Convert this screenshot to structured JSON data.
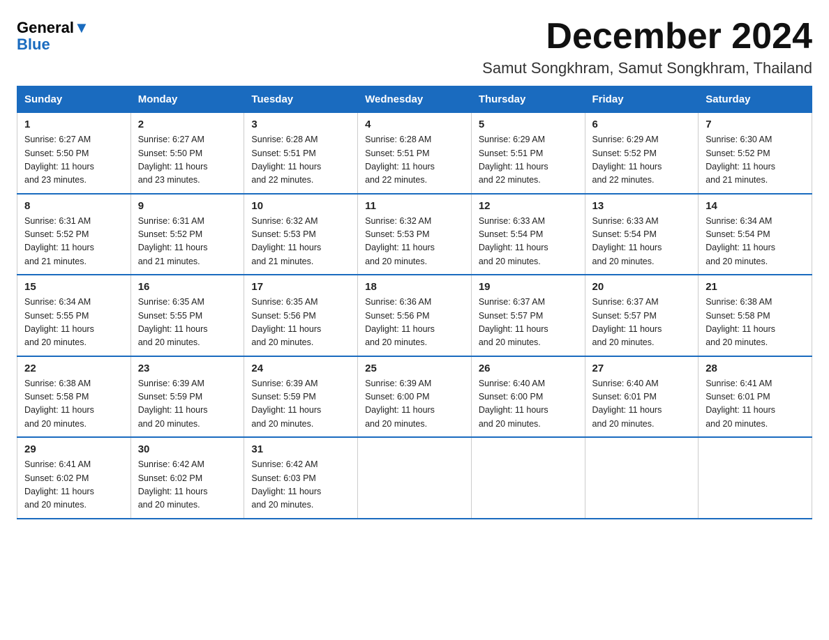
{
  "logo": {
    "line1": "General",
    "line2": "Blue"
  },
  "title": "December 2024",
  "location": "Samut Songkhram, Samut Songkhram, Thailand",
  "days_of_week": [
    "Sunday",
    "Monday",
    "Tuesday",
    "Wednesday",
    "Thursday",
    "Friday",
    "Saturday"
  ],
  "weeks": [
    [
      {
        "day": "1",
        "info": "Sunrise: 6:27 AM\nSunset: 5:50 PM\nDaylight: 11 hours\nand 23 minutes."
      },
      {
        "day": "2",
        "info": "Sunrise: 6:27 AM\nSunset: 5:50 PM\nDaylight: 11 hours\nand 23 minutes."
      },
      {
        "day": "3",
        "info": "Sunrise: 6:28 AM\nSunset: 5:51 PM\nDaylight: 11 hours\nand 22 minutes."
      },
      {
        "day": "4",
        "info": "Sunrise: 6:28 AM\nSunset: 5:51 PM\nDaylight: 11 hours\nand 22 minutes."
      },
      {
        "day": "5",
        "info": "Sunrise: 6:29 AM\nSunset: 5:51 PM\nDaylight: 11 hours\nand 22 minutes."
      },
      {
        "day": "6",
        "info": "Sunrise: 6:29 AM\nSunset: 5:52 PM\nDaylight: 11 hours\nand 22 minutes."
      },
      {
        "day": "7",
        "info": "Sunrise: 6:30 AM\nSunset: 5:52 PM\nDaylight: 11 hours\nand 21 minutes."
      }
    ],
    [
      {
        "day": "8",
        "info": "Sunrise: 6:31 AM\nSunset: 5:52 PM\nDaylight: 11 hours\nand 21 minutes."
      },
      {
        "day": "9",
        "info": "Sunrise: 6:31 AM\nSunset: 5:52 PM\nDaylight: 11 hours\nand 21 minutes."
      },
      {
        "day": "10",
        "info": "Sunrise: 6:32 AM\nSunset: 5:53 PM\nDaylight: 11 hours\nand 21 minutes."
      },
      {
        "day": "11",
        "info": "Sunrise: 6:32 AM\nSunset: 5:53 PM\nDaylight: 11 hours\nand 20 minutes."
      },
      {
        "day": "12",
        "info": "Sunrise: 6:33 AM\nSunset: 5:54 PM\nDaylight: 11 hours\nand 20 minutes."
      },
      {
        "day": "13",
        "info": "Sunrise: 6:33 AM\nSunset: 5:54 PM\nDaylight: 11 hours\nand 20 minutes."
      },
      {
        "day": "14",
        "info": "Sunrise: 6:34 AM\nSunset: 5:54 PM\nDaylight: 11 hours\nand 20 minutes."
      }
    ],
    [
      {
        "day": "15",
        "info": "Sunrise: 6:34 AM\nSunset: 5:55 PM\nDaylight: 11 hours\nand 20 minutes."
      },
      {
        "day": "16",
        "info": "Sunrise: 6:35 AM\nSunset: 5:55 PM\nDaylight: 11 hours\nand 20 minutes."
      },
      {
        "day": "17",
        "info": "Sunrise: 6:35 AM\nSunset: 5:56 PM\nDaylight: 11 hours\nand 20 minutes."
      },
      {
        "day": "18",
        "info": "Sunrise: 6:36 AM\nSunset: 5:56 PM\nDaylight: 11 hours\nand 20 minutes."
      },
      {
        "day": "19",
        "info": "Sunrise: 6:37 AM\nSunset: 5:57 PM\nDaylight: 11 hours\nand 20 minutes."
      },
      {
        "day": "20",
        "info": "Sunrise: 6:37 AM\nSunset: 5:57 PM\nDaylight: 11 hours\nand 20 minutes."
      },
      {
        "day": "21",
        "info": "Sunrise: 6:38 AM\nSunset: 5:58 PM\nDaylight: 11 hours\nand 20 minutes."
      }
    ],
    [
      {
        "day": "22",
        "info": "Sunrise: 6:38 AM\nSunset: 5:58 PM\nDaylight: 11 hours\nand 20 minutes."
      },
      {
        "day": "23",
        "info": "Sunrise: 6:39 AM\nSunset: 5:59 PM\nDaylight: 11 hours\nand 20 minutes."
      },
      {
        "day": "24",
        "info": "Sunrise: 6:39 AM\nSunset: 5:59 PM\nDaylight: 11 hours\nand 20 minutes."
      },
      {
        "day": "25",
        "info": "Sunrise: 6:39 AM\nSunset: 6:00 PM\nDaylight: 11 hours\nand 20 minutes."
      },
      {
        "day": "26",
        "info": "Sunrise: 6:40 AM\nSunset: 6:00 PM\nDaylight: 11 hours\nand 20 minutes."
      },
      {
        "day": "27",
        "info": "Sunrise: 6:40 AM\nSunset: 6:01 PM\nDaylight: 11 hours\nand 20 minutes."
      },
      {
        "day": "28",
        "info": "Sunrise: 6:41 AM\nSunset: 6:01 PM\nDaylight: 11 hours\nand 20 minutes."
      }
    ],
    [
      {
        "day": "29",
        "info": "Sunrise: 6:41 AM\nSunset: 6:02 PM\nDaylight: 11 hours\nand 20 minutes."
      },
      {
        "day": "30",
        "info": "Sunrise: 6:42 AM\nSunset: 6:02 PM\nDaylight: 11 hours\nand 20 minutes."
      },
      {
        "day": "31",
        "info": "Sunrise: 6:42 AM\nSunset: 6:03 PM\nDaylight: 11 hours\nand 20 minutes."
      },
      {
        "day": "",
        "info": ""
      },
      {
        "day": "",
        "info": ""
      },
      {
        "day": "",
        "info": ""
      },
      {
        "day": "",
        "info": ""
      }
    ]
  ]
}
